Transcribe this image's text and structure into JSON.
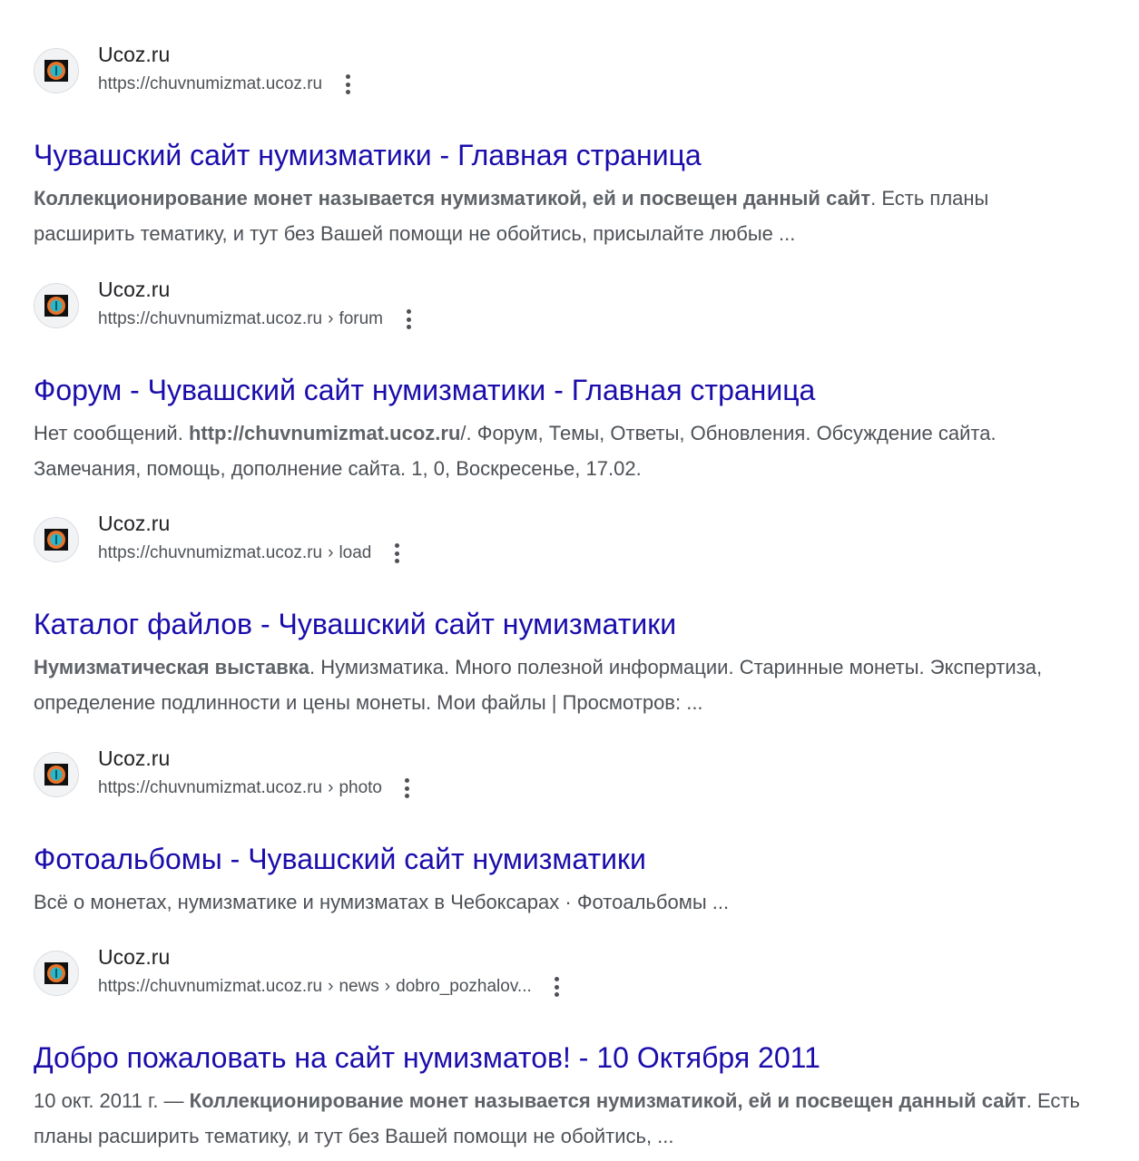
{
  "results": [
    {
      "site_name": "Ucoz.ru",
      "url": "https://chuvnumizmat.ucoz.ru",
      "path": [],
      "title": "Чувашский сайт нумизматики - Главная страница",
      "snippet": [
        {
          "text": "Коллекционирование монет называется нумизматикой, ей и посвещен данный сайт",
          "bold": true
        },
        {
          "text": ". Есть планы расширить тематику, и тут без Вашей помощи не обойтись, присылайте любые ...",
          "bold": false
        }
      ]
    },
    {
      "site_name": "Ucoz.ru",
      "url": "https://chuvnumizmat.ucoz.ru",
      "path": [
        "forum"
      ],
      "title": "Форум - Чувашский сайт нумизматики - Главная страница",
      "snippet": [
        {
          "text": "Нет сообщений. ",
          "bold": false
        },
        {
          "text": "http://chuvnumizmat.ucoz.ru",
          "bold": true
        },
        {
          "text": "/. Форум, Темы, Ответы, Обновления. Обсуждение сайта. Замечания, помощь, дополнение сайта. 1, 0, Воскресенье, 17.02.",
          "bold": false
        }
      ]
    },
    {
      "site_name": "Ucoz.ru",
      "url": "https://chuvnumizmat.ucoz.ru",
      "path": [
        "load"
      ],
      "title": "Каталог файлов - Чувашский сайт нумизматики",
      "snippet": [
        {
          "text": "Нумизматическая выставка",
          "bold": true
        },
        {
          "text": ". Нумизматика. Много полезной информации. Старинные монеты. Экспертиза, определение подлинности и цены монеты. Мои файлы | Просмотров: ...",
          "bold": false
        }
      ]
    },
    {
      "site_name": "Ucoz.ru",
      "url": "https://chuvnumizmat.ucoz.ru",
      "path": [
        "photo"
      ],
      "title": "Фотоальбомы - Чувашский сайт нумизматики",
      "snippet": [
        {
          "text": "Всё о монетах, нумизматике и нумизматах в Чебоксарах · Фотоальбомы ...",
          "bold": false
        }
      ]
    },
    {
      "site_name": "Ucoz.ru",
      "url": "https://chuvnumizmat.ucoz.ru",
      "path": [
        "news",
        "dobro_pozhalov..."
      ],
      "title": "Добро пожаловать на сайт нумизматов! - 10 Октября 2011",
      "snippet": [
        {
          "text": "10 окт. 2011 г. — ",
          "bold": false
        },
        {
          "text": "Коллекционирование монет называется нумизматикой, ей и посвещен данный сайт",
          "bold": true
        },
        {
          "text": ". Есть планы расширить тематику, и тут без Вашей помощи не обойтись, ...",
          "bold": false
        }
      ]
    }
  ],
  "icons": {
    "favicon": "ucoz-favicon-icon",
    "menu": "more-vert-icon",
    "breadcrumb_separator": "›"
  },
  "colors": {
    "title_link": "#1a0dab",
    "snippet_text": "#4d5156",
    "snippet_bold": "#5f6368",
    "site_name": "#202124"
  }
}
